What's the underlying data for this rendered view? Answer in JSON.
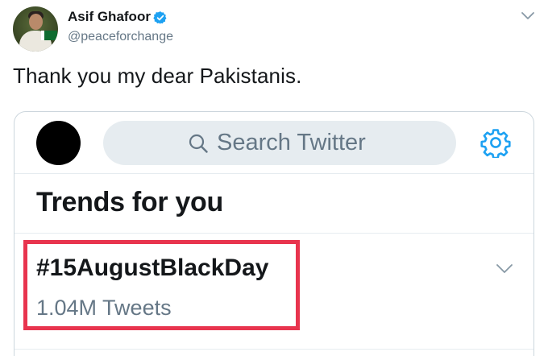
{
  "tweet": {
    "author_name": "Asif Ghafoor",
    "handle": "@peaceforchange",
    "verified_icon": "verified-badge-icon",
    "text": "Thank you my dear Pakistanis."
  },
  "screenshot": {
    "search": {
      "placeholder": "Search Twitter",
      "icon": "search-icon"
    },
    "settings_icon": "gear-icon",
    "trends_title": "Trends for you",
    "trends": [
      {
        "name": "#15AugustBlackDay",
        "count": "1.04M Tweets"
      }
    ],
    "highlight_color": "#e8344e"
  },
  "colors": {
    "twitter_blue": "#1da1f2",
    "text_primary": "#14171a",
    "text_secondary": "#657786",
    "search_bg": "#e6ecf0"
  }
}
